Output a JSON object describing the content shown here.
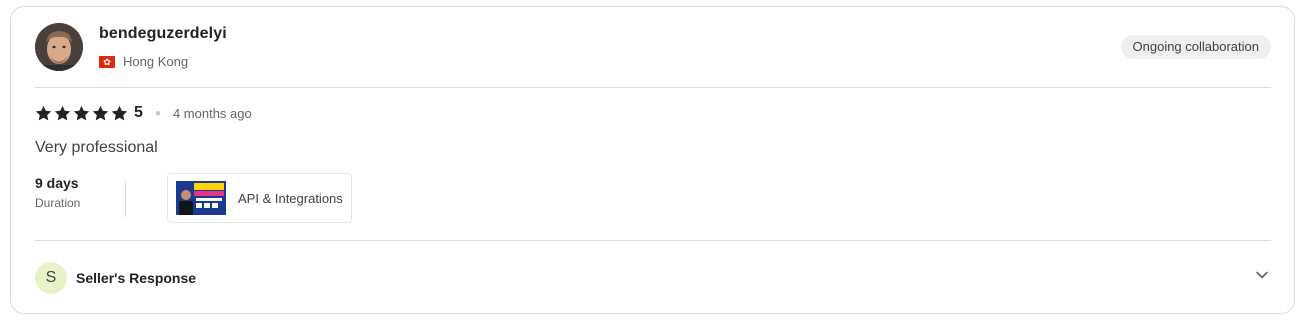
{
  "reviewer": {
    "username": "bendeguzerdelyi",
    "country": "Hong Kong",
    "flag_icon": "hong-kong-flag-icon",
    "flag_color": "#de2910"
  },
  "badge": {
    "label": "Ongoing collaboration"
  },
  "rating": {
    "value": "5",
    "stars": 5,
    "time_ago": "4 months ago",
    "star_color": "#222325"
  },
  "review": {
    "text": "Very professional"
  },
  "duration": {
    "value": "9 days",
    "label": "Duration"
  },
  "gig": {
    "label": "API & Integrations"
  },
  "seller_response": {
    "initial": "S",
    "label": "Seller's Response"
  }
}
